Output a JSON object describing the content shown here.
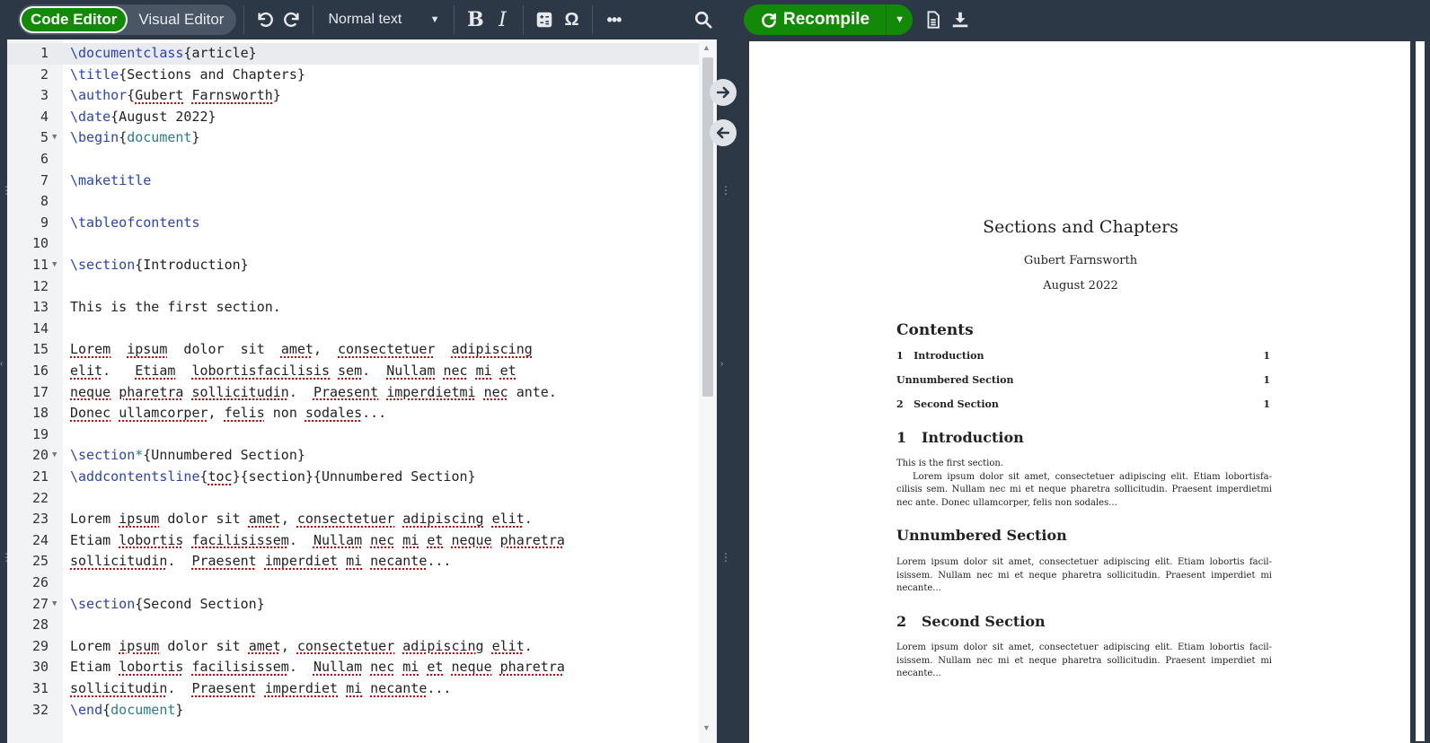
{
  "toolbar": {
    "code_editor": "Code Editor",
    "visual_editor": "Visual Editor",
    "text_style": "Normal text",
    "recompile": "Recompile",
    "bold": "B",
    "italic": "I",
    "omega": "Ω"
  },
  "editor": {
    "lines": [
      {
        "n": "1"
      },
      {
        "n": "2"
      },
      {
        "n": "3"
      },
      {
        "n": "4"
      },
      {
        "n": "5"
      },
      {
        "n": "6"
      },
      {
        "n": "7"
      },
      {
        "n": "8"
      },
      {
        "n": "9"
      },
      {
        "n": "10"
      },
      {
        "n": "11"
      },
      {
        "n": "12"
      },
      {
        "n": "13"
      },
      {
        "n": "14"
      },
      {
        "n": "15"
      },
      {
        "n": "16"
      },
      {
        "n": "17"
      },
      {
        "n": "18"
      },
      {
        "n": "19"
      },
      {
        "n": "20"
      },
      {
        "n": "21"
      },
      {
        "n": "22"
      },
      {
        "n": "23"
      },
      {
        "n": "24"
      },
      {
        "n": "25"
      },
      {
        "n": "26"
      },
      {
        "n": "27"
      },
      {
        "n": "28"
      },
      {
        "n": "29"
      },
      {
        "n": "30"
      },
      {
        "n": "31"
      },
      {
        "n": "32"
      }
    ],
    "code": {
      "l1a": "\\documentclass",
      "l1b": "{article}",
      "l2a": "\\title",
      "l2b": "{Sections and Chapters}",
      "l3a": "\\author",
      "l3b": "{",
      "l3c": "Gubert",
      "l3d": " ",
      "l3e": "Farnsworth",
      "l3f": "}",
      "l4a": "\\date",
      "l4b": "{August 2022}",
      "l5a": "\\begin",
      "l5b": "{",
      "l5c": "document",
      "l5d": "}",
      "l7": "\\maketitle",
      "l9": "\\tableofcontents",
      "l11a": "\\section",
      "l11b": "{Introduction}",
      "l13": "This is the first section.",
      "l15a": "Lorem",
      "l15b": "  ",
      "l15c": "ipsum",
      "l15d": "  dolor  sit  ",
      "l15e": "amet",
      "l15f": ",  ",
      "l15g": "consectetuer",
      "l15h": "  ",
      "l15i": "adipiscing",
      "l16a": "elit",
      "l16b": ".   ",
      "l16c": "Etiam",
      "l16d": "  ",
      "l16e": "lobortisfacilisis",
      "l16f": " ",
      "l16g": "sem",
      "l16h": ".  ",
      "l16i": "Nullam",
      "l16j": " ",
      "l16k": "nec",
      "l16l": " ",
      "l16m": "mi",
      "l16n": " ",
      "l16o": "et",
      "l17a": "neque",
      "l17b": " ",
      "l17c": "pharetra",
      "l17d": " ",
      "l17e": "sollicitudin",
      "l17f": ".  ",
      "l17g": "Praesent",
      "l17h": " ",
      "l17i": "imperdietmi",
      "l17j": " ",
      "l17k": "nec",
      "l17l": " ante.",
      "l18a": "Donec",
      "l18b": " ",
      "l18c": "ullamcorper",
      "l18d": ", ",
      "l18e": "felis",
      "l18f": " non ",
      "l18g": "sodales",
      "l18h": "...",
      "l20a": "\\section",
      "l20b": "*",
      "l20c": "{Unnumbered Section}",
      "l21a": "\\addcontentsline",
      "l21b": "{",
      "l21c": "toc",
      "l21d": "}{section}{Unnumbered Section}",
      "l23a": "Lorem",
      "l23b": " ",
      "l23c": "ipsum",
      "l23d": " dolor sit ",
      "l23e": "amet",
      "l23f": ", ",
      "l23g": "consectetuer",
      "l23h": " ",
      "l23i": "adipiscing",
      "l23j": " ",
      "l23k": "elit",
      "l23l": ".",
      "l24a": "Etiam",
      "l24b": " ",
      "l24c": "lobortis",
      "l24d": " ",
      "l24e": "facilisissem",
      "l24f": ".  ",
      "l24g": "Nullam",
      "l24h": " ",
      "l24i": "nec",
      "l24j": " ",
      "l24k": "mi",
      "l24l": " ",
      "l24m": "et",
      "l24n": " ",
      "l24o": "neque",
      "l24p": " ",
      "l24q": "pharetra",
      "l25a": "sollicitudin",
      "l25b": ".  ",
      "l25c": "Praesent",
      "l25d": " ",
      "l25e": "imperdiet",
      "l25f": " ",
      "l25g": "mi",
      "l25h": " ",
      "l25i": "necante",
      "l25j": "...",
      "l27a": "\\section",
      "l27b": "{Second Section}",
      "l32a": "\\end",
      "l32b": "{",
      "l32c": "document",
      "l32d": "}"
    }
  },
  "pdf": {
    "title": "Sections and Chapters",
    "author": "Gubert Farnsworth",
    "date": "August 2022",
    "contents_heading": "Contents",
    "toc": [
      {
        "num": "1",
        "label": "Introduction",
        "page": "1"
      },
      {
        "num": "",
        "label": "Unnumbered Section",
        "page": "1"
      },
      {
        "num": "2",
        "label": "Second Section",
        "page": "1"
      }
    ],
    "sec1_num": "1",
    "sec1_title": "Introduction",
    "sec1_first": "This is the first section.",
    "sec1_para": "Lorem ipsum dolor sit amet, consectetuer adipiscing elit. Etiam lobortisfa-cilisis sem. Nullam nec mi et neque pharetra sollicitudin. Praesent imperdietmi nec ante. Donec ullamcorper, felis non sodales...",
    "sec_unnum_title": "Unnumbered Section",
    "sec_unnum_para": "Lorem ipsum dolor sit amet, consectetuer adipiscing elit. Etiam lobortis facil-isissem. Nullam nec mi et neque pharetra sollicitudin. Praesent imperdiet mi necante...",
    "sec2_num": "2",
    "sec2_title": "Second Section",
    "sec2_para": "Lorem ipsum dolor sit amet, consectetuer adipiscing elit. Etiam lobortis facil-isissem. Nullam nec mi et neque pharetra sollicitudin. Praesent imperdiet mi necante..."
  },
  "colors": {
    "toolbar_bg": "#2d3846",
    "accent_green": "#138a07",
    "latex_command": "#2b43b8",
    "latex_env": "#2e7d85",
    "spell_error": "#e00000"
  }
}
